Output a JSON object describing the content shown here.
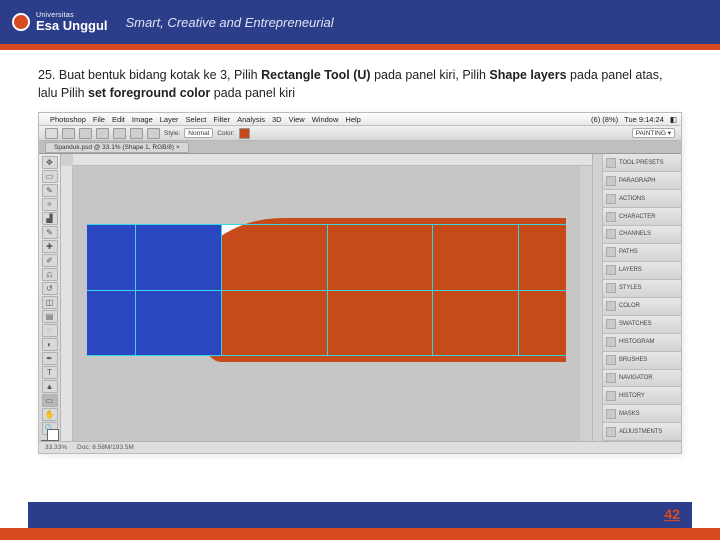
{
  "header": {
    "brand_top": "Universitas",
    "brand": "Esa Unggul",
    "tagline": "Smart, Creative and Entrepreneurial"
  },
  "instruction": {
    "number": "25.",
    "t1": "Buat bentuk bidang kotak ke 3, Pilih ",
    "b1": "Rectangle Tool (U)",
    "t2": " pada panel kiri, Pilih ",
    "b2": "Shape layers",
    "t3": " pada panel atas, lalu Pilih ",
    "b3": "set foreground color",
    "t4": " pada panel kiri"
  },
  "photoshop": {
    "menubar": [
      "Photoshop",
      "File",
      "Edit",
      "Image",
      "Layer",
      "Select",
      "Filter",
      "Analysis",
      "3D",
      "View",
      "Window",
      "Help"
    ],
    "menu_right": [
      "(6) (8%)",
      "Tue 9:14:24",
      "◧"
    ],
    "optionbar": {
      "style_label": "Style:",
      "style_value": "Normal",
      "color_label": "Color:",
      "right_label": "PAINTING ▾"
    },
    "doc_tab": "Spanduk.psd @ 33.1% (Shape 1, RGB/8) ×",
    "panels": [
      "TOOL PRESETS",
      "PARAGRAPH",
      "ACTIONS",
      "CHARACTER",
      "CHANNELS",
      "PATHS",
      "LAYERS",
      "STYLES",
      "COLOR",
      "SWATCHES",
      "HISTOGRAM",
      "BRUSHES",
      "NAVIGATOR",
      "HISTORY",
      "MASKS",
      "ADJUSTMENTS"
    ],
    "status": {
      "zoom": "33.33%",
      "doc": "Doc: 8.58M/193.5M"
    }
  },
  "footer": {
    "page": "42"
  }
}
